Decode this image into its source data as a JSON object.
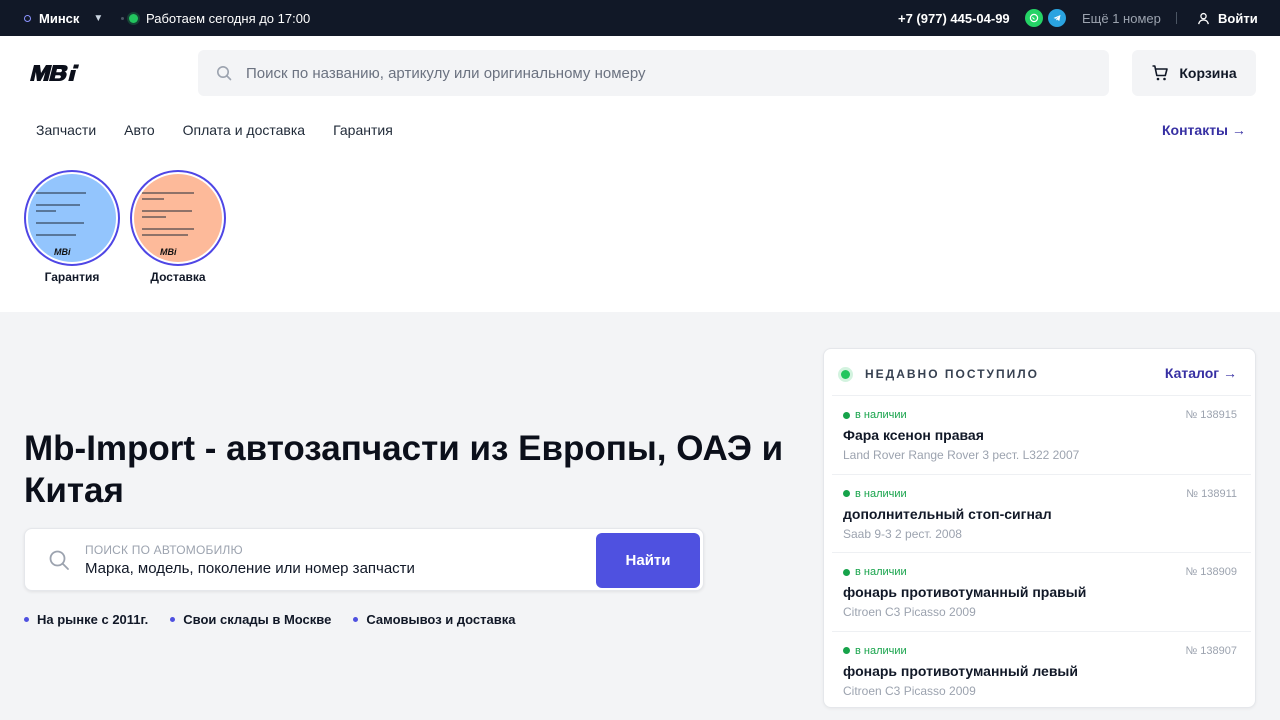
{
  "topbar": {
    "city": "Минск",
    "hours": "Работаем сегодня до 17:00",
    "phone": "+7 (977) 445-04-99",
    "more_numbers": "Ещё 1 номер",
    "login": "Войти",
    "icons": [
      "whatsapp-icon",
      "telegram-icon",
      "user-icon"
    ]
  },
  "header": {
    "logo_text": "MBi",
    "search_placeholder": "Поиск по названию, артикулу или оригинальному номеру",
    "cart_label": "Корзина"
  },
  "nav": {
    "items": [
      "Запчасти",
      "Авто",
      "Оплата и доставка",
      "Гарантия"
    ],
    "contacts": "Контакты →"
  },
  "stories": [
    {
      "label": "Гарантия",
      "bg": "#93c5fd"
    },
    {
      "label": "Доставка",
      "bg": "#fdba9a"
    }
  ],
  "hero": {
    "title": "Mb-Import - автозапчасти из Европы, ОАЭ и Китая",
    "search_caption": "ПОИСК ПО АВТОМОБИЛЮ",
    "search_placeholder": "Марка, модель, поколение или номер запчасти",
    "search_button": "Найти",
    "features": [
      "На рынке с 2011г.",
      "Свои склады в Москве",
      "Самовывоз и доставка"
    ]
  },
  "recent": {
    "title": "НЕДАВНО ПОСТУПИЛО",
    "catalog_link": "Каталог →",
    "items": [
      {
        "stock": "в наличии",
        "number": "№ 138915",
        "name": "Фара ксенон правая",
        "car": "Land Rover Range Rover 3 рест. L322 2007"
      },
      {
        "stock": "в наличии",
        "number": "№ 138911",
        "name": "дополнительный стоп-сигнал",
        "car": "Saab 9-3 2 рест. 2008"
      },
      {
        "stock": "в наличии",
        "number": "№ 138909",
        "name": "фонарь противотуманный правый",
        "car": "Citroen C3 Picasso 2009"
      },
      {
        "stock": "в наличии",
        "number": "№ 138907",
        "name": "фонарь противотуманный левый",
        "car": "Citroen C3 Picasso 2009"
      }
    ]
  },
  "colors": {
    "topbar_bg": "#111827",
    "accent": "#4f51e0",
    "link": "#3730a3",
    "in_stock": "#16a34a"
  }
}
